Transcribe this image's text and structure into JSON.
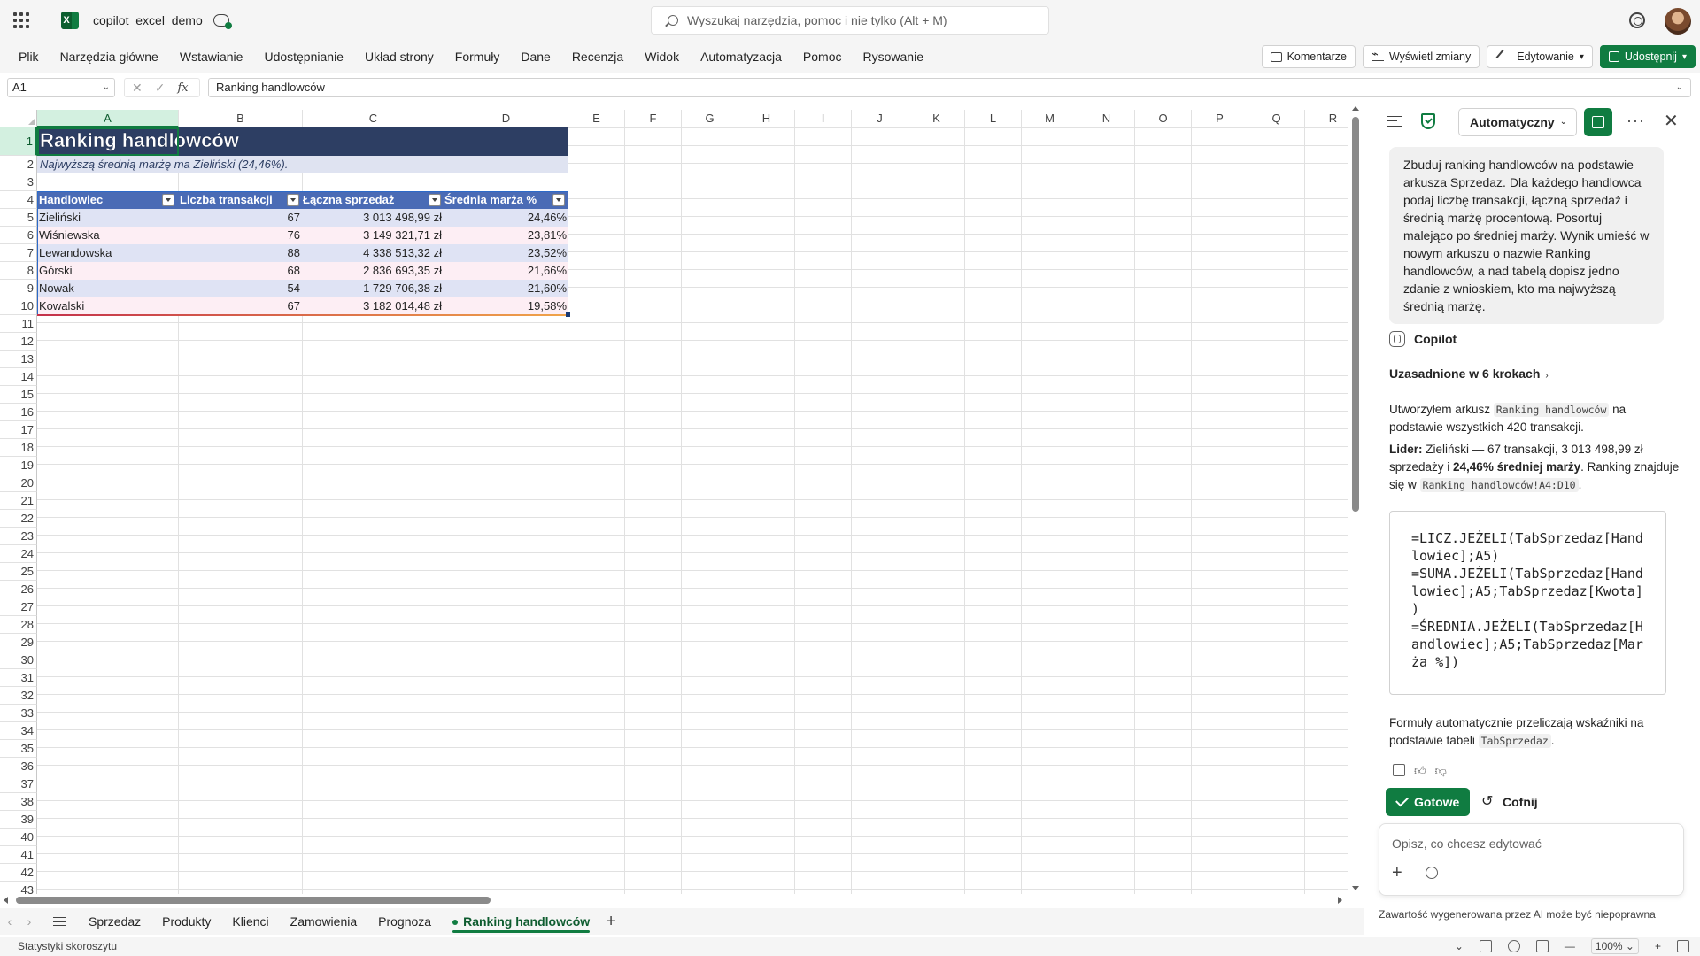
{
  "app": {
    "doc_title": "copilot_excel_demo",
    "search_placeholder": "Wyszukaj narzędzia, pomoc i nie tylko (Alt + M)"
  },
  "ribbon": {
    "tabs": [
      "Plik",
      "Narzędzia główne",
      "Wstawianie",
      "Udostępnianie",
      "Układ strony",
      "Formuły",
      "Dane",
      "Recenzja",
      "Widok",
      "Automatyzacja",
      "Pomoc",
      "Rysowanie"
    ],
    "comments": "Komentarze",
    "show_changes": "Wyświetl zmiany",
    "editing": "Edytowanie",
    "share": "Udostępnij"
  },
  "formula_bar": {
    "name_box": "A1",
    "fx": "fx",
    "content": "Ranking handlowców"
  },
  "grid": {
    "columns": [
      "A",
      "B",
      "C",
      "D",
      "E",
      "F",
      "G",
      "H",
      "I",
      "J",
      "K",
      "L",
      "M",
      "N",
      "O",
      "P",
      "Q",
      "R"
    ],
    "rows": [
      1,
      2,
      3,
      4,
      5,
      6,
      7,
      8,
      9,
      10,
      11,
      12,
      13,
      14,
      15,
      16,
      17,
      18,
      19,
      20,
      21,
      22,
      23,
      24,
      25,
      26,
      27,
      28,
      29,
      30,
      31,
      32,
      33,
      34,
      35,
      36,
      37,
      38,
      39,
      40,
      41,
      42,
      43
    ],
    "title": "Ranking handlowców",
    "subtitle": "Najwyższą średnią marżę ma Zieliński (24,46%).",
    "table": {
      "headers": [
        "Handlowiec",
        "Liczba transakcji",
        "Łączna sprzedaż",
        "Średnia marża %"
      ],
      "rows": [
        [
          "Zieliński",
          "67",
          "3 013 498,99 zł",
          "24,46%"
        ],
        [
          "Wiśniewska",
          "76",
          "3 149 321,71 zł",
          "23,81%"
        ],
        [
          "Lewandowska",
          "88",
          "4 338 513,32 zł",
          "23,52%"
        ],
        [
          "Górski",
          "68",
          "2 836 693,35 zł",
          "21,66%"
        ],
        [
          "Nowak",
          "54",
          "1 729 706,38 zł",
          "21,60%"
        ],
        [
          "Kowalski",
          "67",
          "3 182 014,48 zł",
          "19,58%"
        ]
      ]
    }
  },
  "sheets": {
    "tabs": [
      "Sprzedaz",
      "Produkty",
      "Klienci",
      "Zamowienia",
      "Prognoza",
      "Ranking handlowców"
    ],
    "active_index": 5
  },
  "status": {
    "left": "Statystyki skoroszytu",
    "zoom": "100%"
  },
  "copilot": {
    "mode": "Automatyczny",
    "user_message": "Zbuduj ranking handlowców na podstawie arkusza Sprzedaz. Dla każdego handlowca podaj liczbę transakcji, łączną sprzedaż i średnią marżę procentową. Posortuj malejąco po średniej marży. Wynik umieść w nowym arkuszu o nazwie Ranking handlowców, a nad tabelą dopisz jedno zdanie z wnioskiem, kto ma najwyższą średnią marżę.",
    "assistant_name": "Copilot",
    "reasoned_steps": "Uzasadnione w 6 krokach",
    "answer_p1_pre": "Utworzyłem arkusz ",
    "answer_p1_code": "Ranking handlowców",
    "answer_p1_post": " na podstawie wszystkich 420 transakcji.",
    "answer_p2_bold1": "Lider:",
    "answer_p2_text1": " Zieliński — 67 transakcji, 3 013 498,99 zł sprzedaży i ",
    "answer_p2_bold2": "24,46% średniej marży",
    "answer_p2_text2": ". Ranking znajduje się w ",
    "answer_p2_code": "Ranking handlowców!A4:D10",
    "answer_p2_end": ".",
    "code_block": "=LICZ.JEŻELI(TabSprzedaz[Hand\nlowiec];A5)\n=SUMA.JEŻELI(TabSprzedaz[Hand\nlowiec];A5;TabSprzedaz[Kwota]\n)\n=ŚREDNIA.JEŻELI(TabSprzedaz[H\nandlowiec];A5;TabSprzedaz[Mar\nża %])",
    "answer_p3_pre": "Formuły automatycznie przeliczają wskaźniki na podstawie tabeli ",
    "answer_p3_code": "TabSprzedaz",
    "answer_p3_post": ".",
    "done_label": "Gotowe",
    "undo_label": "Cofnij",
    "composer_placeholder": "Opisz, co chcesz edytować",
    "disclaimer": "Zawartość wygenerowana przez AI może być niepoprawna"
  },
  "colors": {
    "accent": "#107c41",
    "title_fill": "#2d3e63",
    "table_header": "#4a6bb5"
  }
}
